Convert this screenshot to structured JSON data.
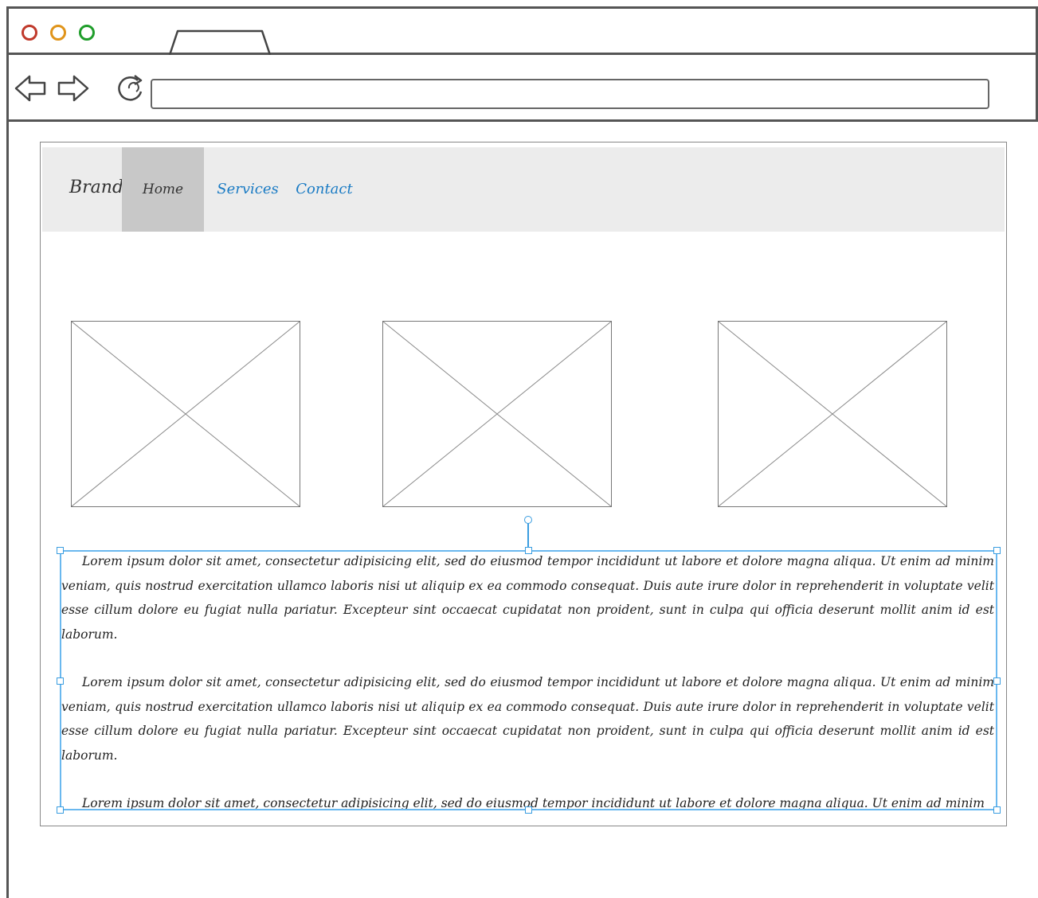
{
  "browser": {
    "address_value": "",
    "traffic_lights": {
      "close": "#c0392b",
      "minimize": "#e0941a",
      "maximize": "#1f9d2a"
    }
  },
  "navbar": {
    "brand": "Brand",
    "items": [
      {
        "label": "Home",
        "active": true
      },
      {
        "label": "Services",
        "active": false
      },
      {
        "label": "Contact",
        "active": false
      }
    ],
    "link_color": "#1a7bc4"
  },
  "content": {
    "paragraphs": [
      "Lorem ipsum dolor sit amet, consectetur adipisicing elit, sed do eiusmod tempor incididunt ut labore et dolore magna aliqua. Ut enim ad minim veniam, quis nostrud exercitation ullamco laboris nisi ut aliquip ex ea commodo consequat. Duis aute irure dolor in reprehenderit in voluptate velit esse cillum dolore eu fugiat nulla pariatur. Excepteur sint occaecat cupidatat non proident, sunt in culpa qui officia deserunt mollit anim id est laborum.",
      "Lorem ipsum dolor sit amet, consectetur adipisicing elit, sed do eiusmod tempor incididunt ut labore et dolore magna aliqua. Ut enim ad minim veniam, quis nostrud exercitation ullamco laboris nisi ut aliquip ex ea commodo consequat. Duis aute irure dolor in reprehenderit in voluptate velit esse cillum dolore eu fugiat nulla pariatur. Excepteur sint occaecat cupidatat non proident, sunt in culpa qui officia deserunt mollit anim id est laborum.",
      "Lorem ipsum dolor sit amet, consectetur adipisicing elit, sed do eiusmod tempor incididunt ut labore et dolore magna aliqua. Ut enim ad minim"
    ]
  },
  "selection_color": "#3a9de0"
}
